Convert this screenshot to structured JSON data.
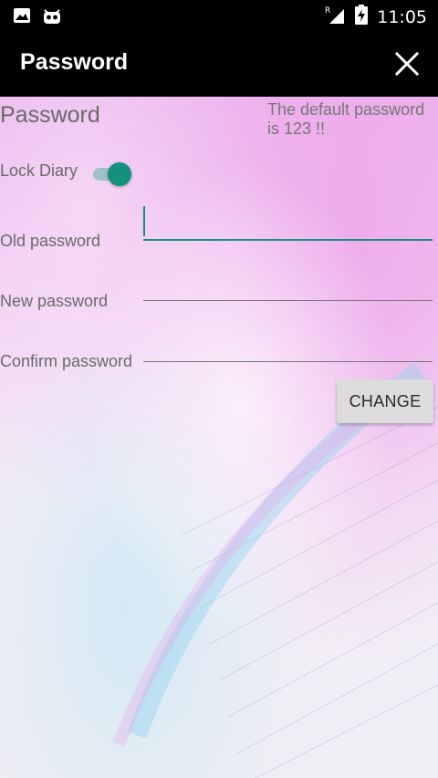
{
  "status_bar": {
    "time": "11:05",
    "left_icons": [
      "image-icon",
      "android-icon"
    ],
    "right_icons": [
      "signal-roaming-icon",
      "battery-charging-icon"
    ],
    "roaming_mark": "R"
  },
  "app_bar": {
    "title": "Password",
    "close_icon": "close-icon"
  },
  "content": {
    "section_title": "Password",
    "hint": "The default password is 123 !!",
    "lock": {
      "label": "Lock Diary",
      "enabled": true
    },
    "fields": {
      "old_password": {
        "label": "Old password",
        "value": ""
      },
      "new_password": {
        "label": "New password",
        "value": ""
      },
      "confirm_password": {
        "label": "Confirm password",
        "value": ""
      }
    },
    "change_button": "CHANGE"
  },
  "colors": {
    "accent": "#13917e",
    "bar_background": "#000000"
  }
}
